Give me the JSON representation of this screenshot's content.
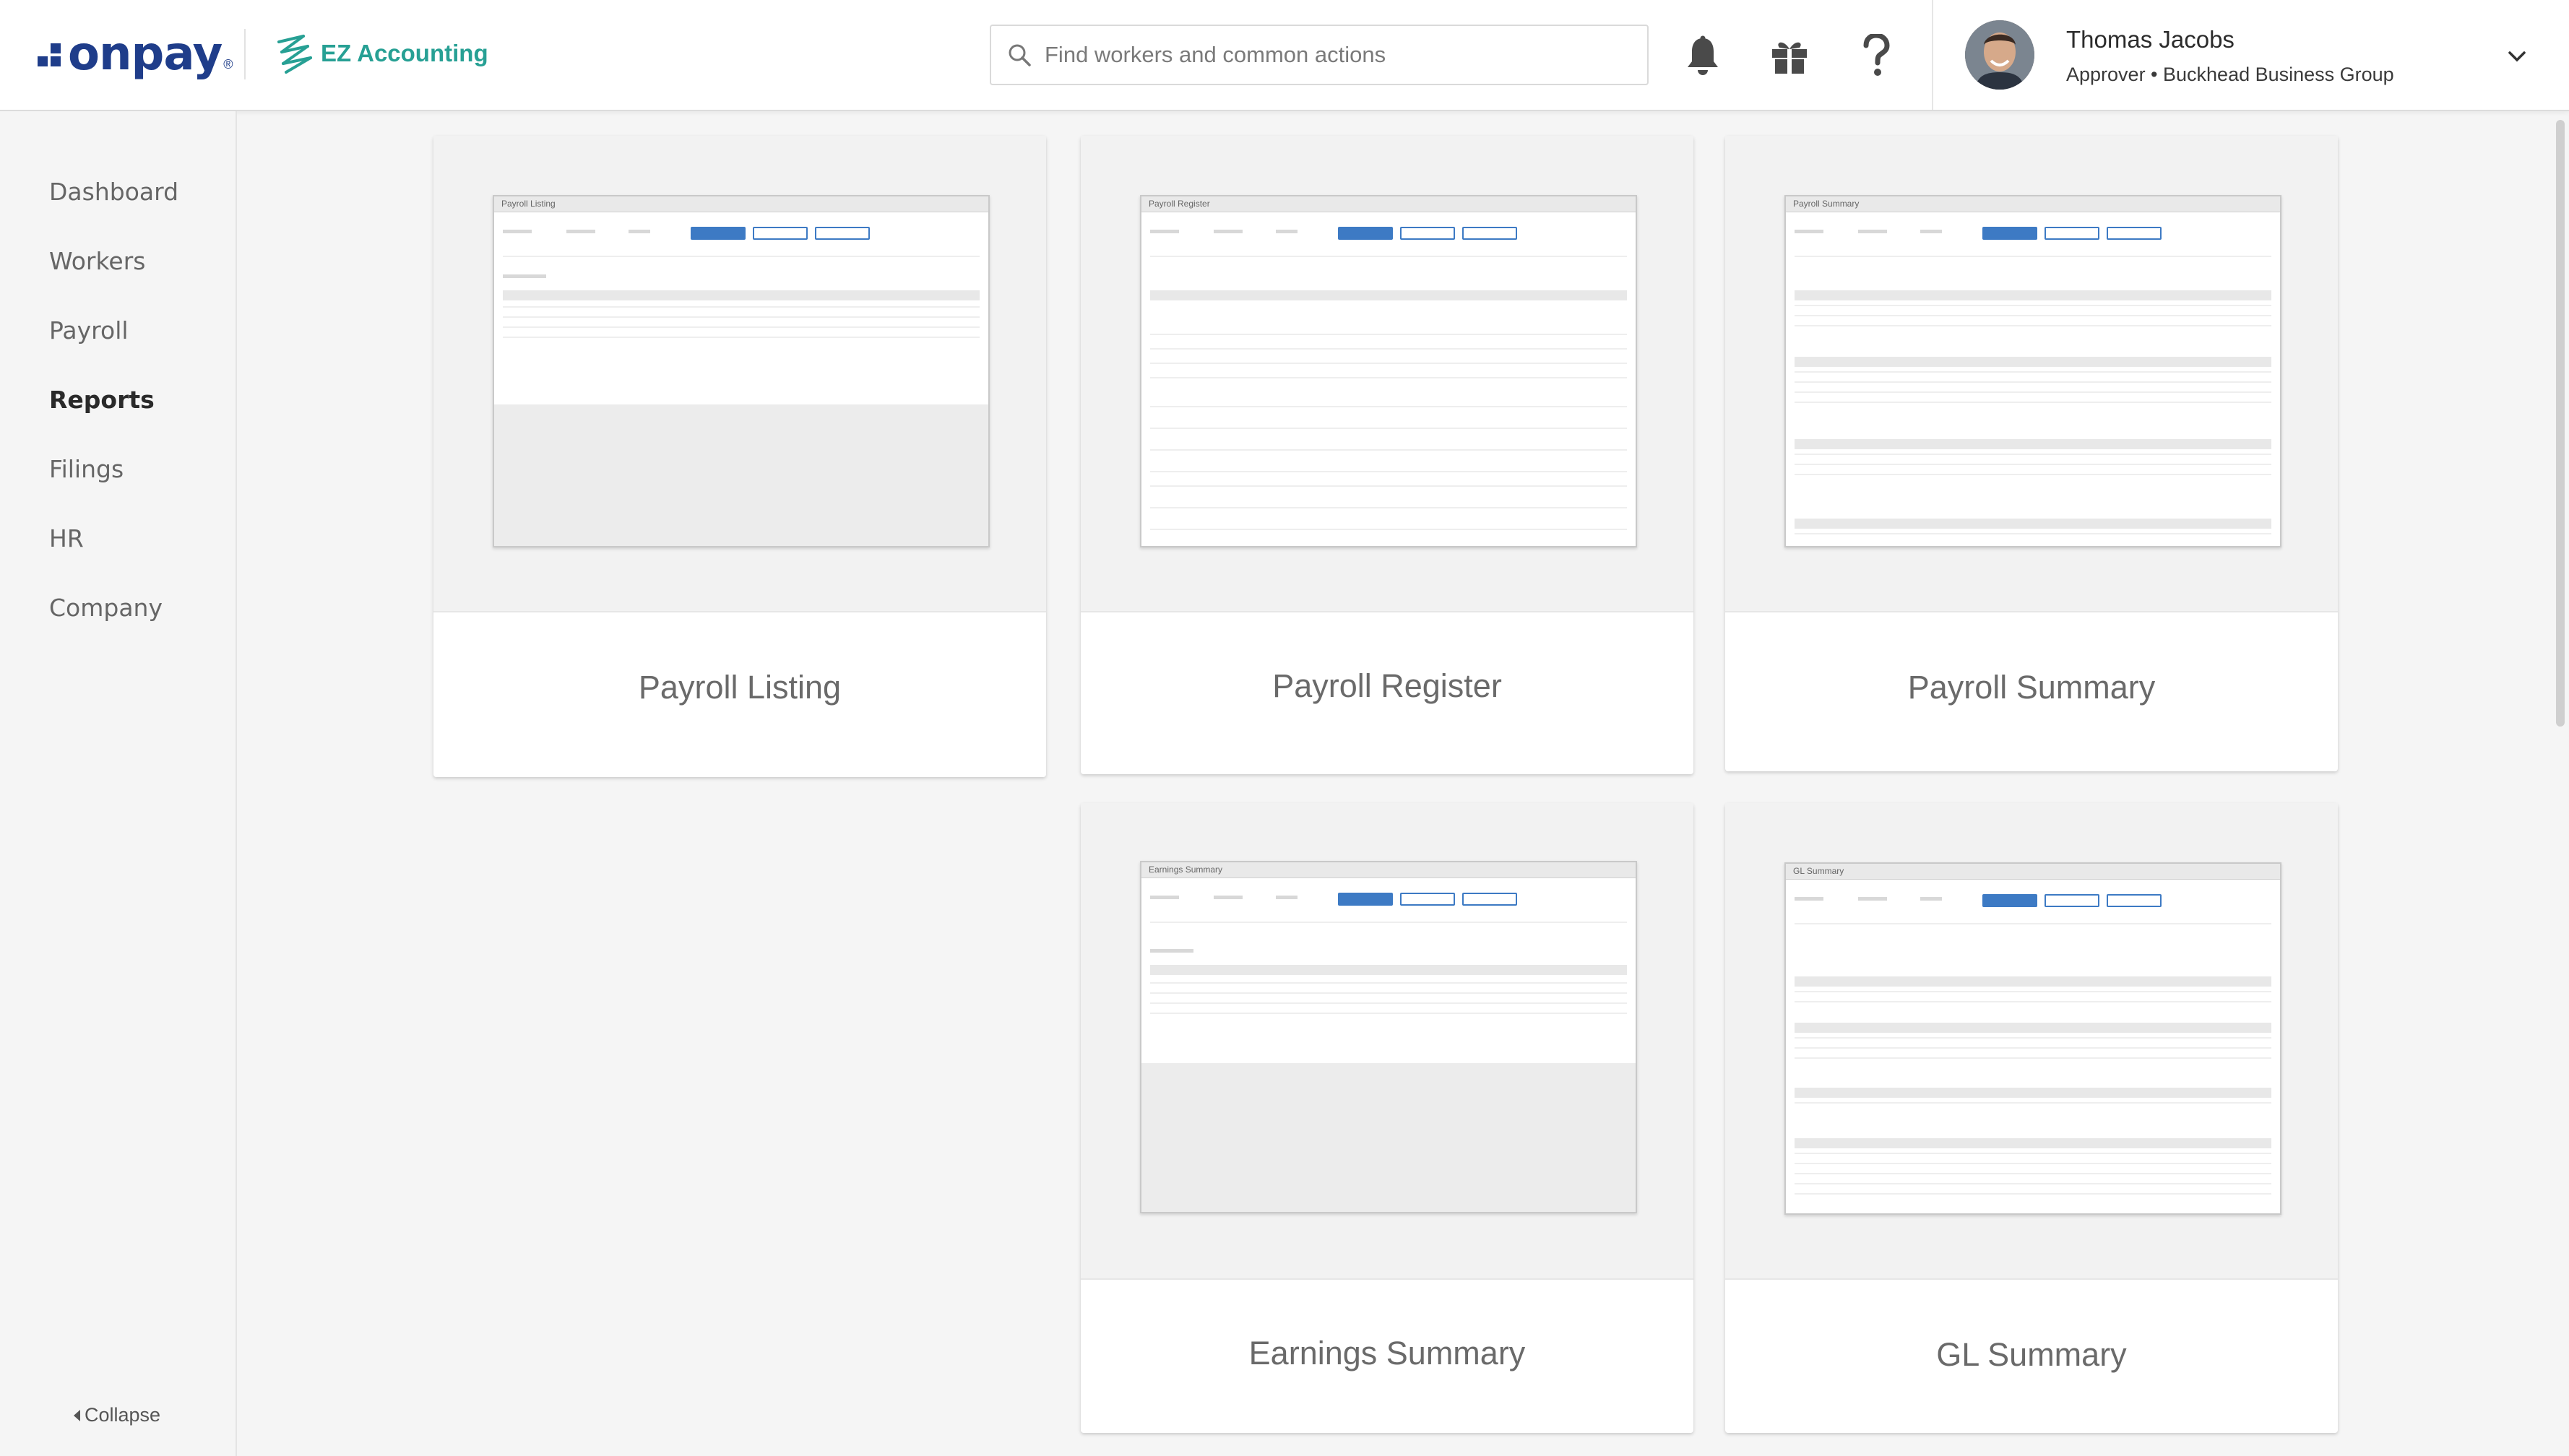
{
  "header": {
    "brand": "onpay",
    "partner": "EZ Accounting",
    "search_placeholder": "Find workers and common actions",
    "user": {
      "name": "Thomas Jacobs",
      "role": "Approver • Buckhead Business Group"
    }
  },
  "sidebar": {
    "items": [
      {
        "label": "Dashboard"
      },
      {
        "label": "Workers"
      },
      {
        "label": "Payroll"
      },
      {
        "label": "Reports"
      },
      {
        "label": "Filings"
      },
      {
        "label": "HR"
      },
      {
        "label": "Company"
      }
    ],
    "active": "Reports",
    "collapse_label": "Collapse"
  },
  "reports": [
    {
      "title": "Payroll Listing",
      "preview_title": "Payroll Listing"
    },
    {
      "title": "Payroll Register",
      "preview_title": "Payroll Register"
    },
    {
      "title": "Payroll Summary",
      "preview_title": "Payroll Summary"
    },
    {
      "title": "Earnings Summary",
      "preview_title": "Earnings Summary"
    },
    {
      "title": "GL Summary",
      "preview_title": "GL Summary"
    }
  ],
  "colors": {
    "brand": "#1f3d8a",
    "partner": "#27a094",
    "accent_button": "#3d7ac4"
  }
}
